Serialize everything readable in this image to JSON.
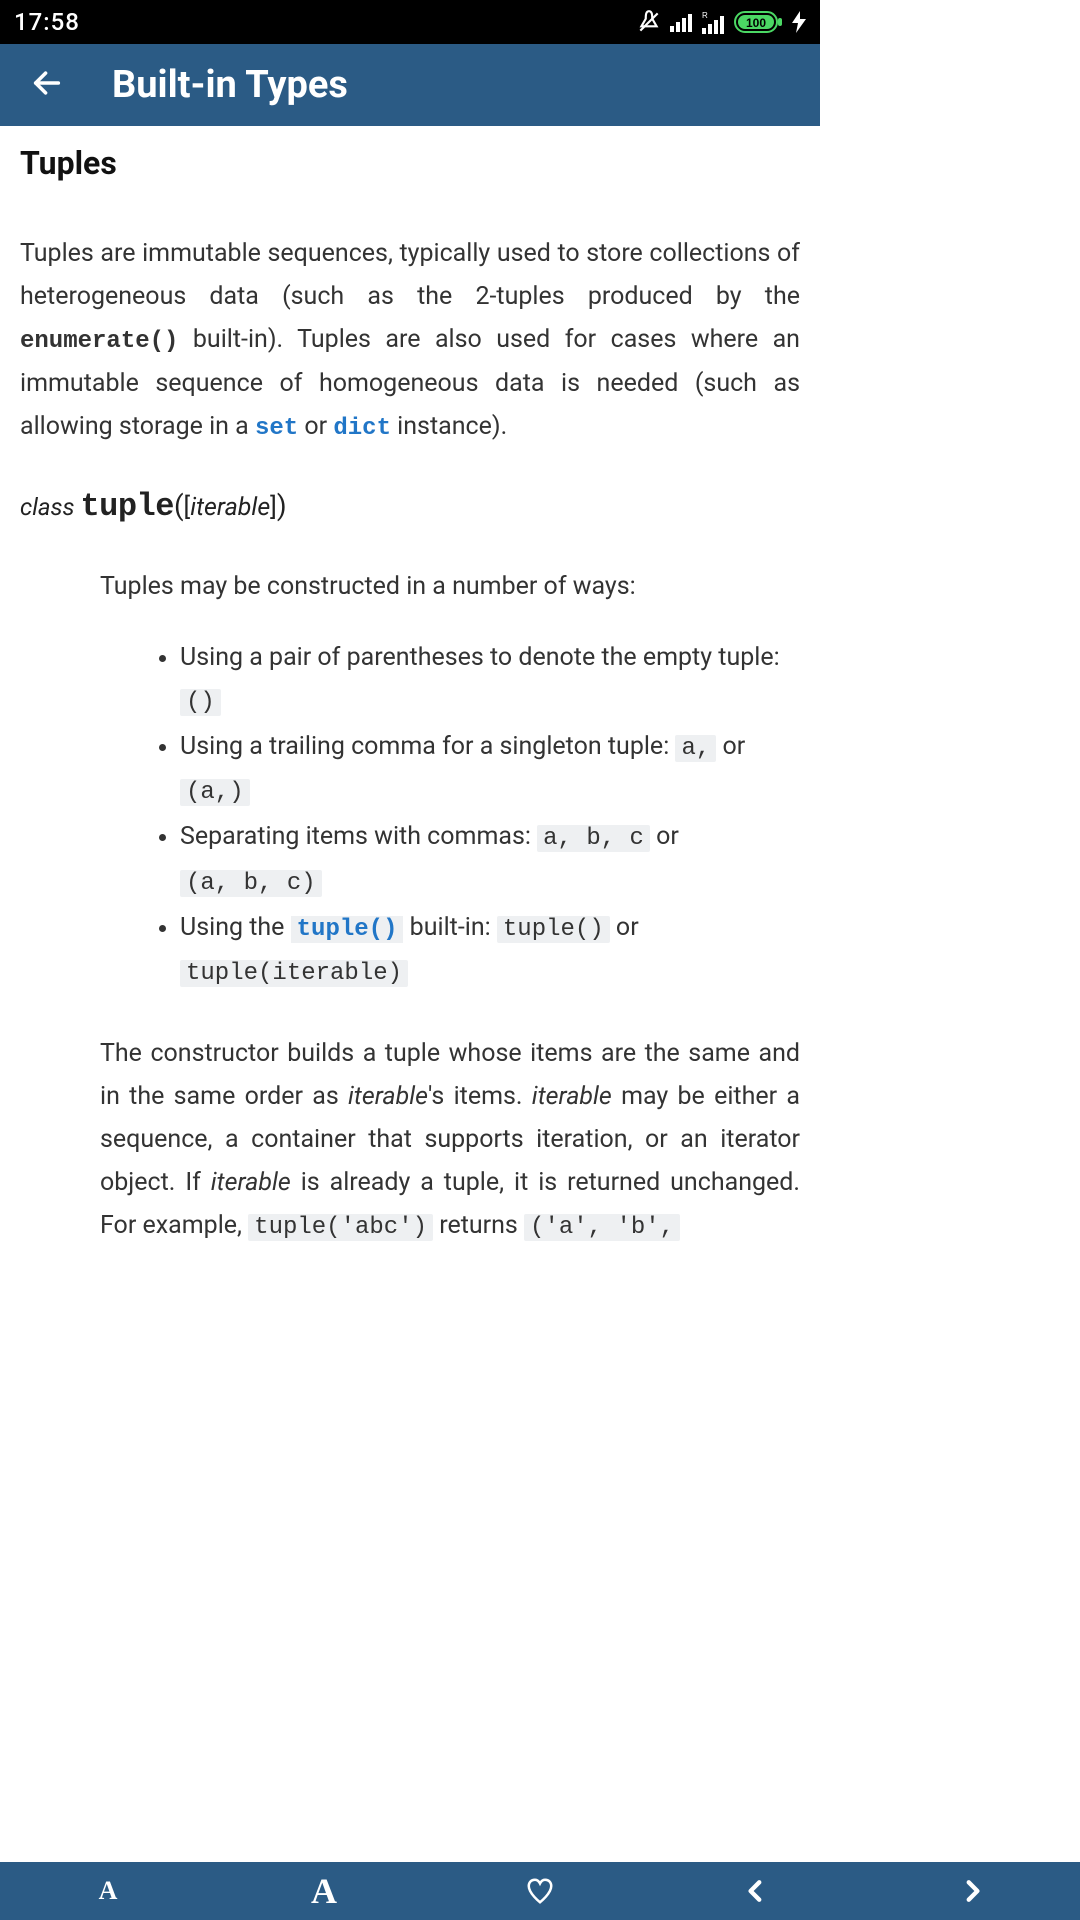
{
  "status": {
    "time": "17:58",
    "battery": "100"
  },
  "header": {
    "title": "Built-in Types"
  },
  "page": {
    "heading": "Tuples",
    "intro": {
      "p1a": "Tuples are immutable sequences, typically used to store collections of heterogeneous data (such as the 2-tuples produced by the ",
      "enum": "enumerate()",
      "p1b": " built-in). Tuples are also used for cases where an immutable sequence of homogeneous data is needed (such as allowing storage in a ",
      "set": "set",
      "or": " or ",
      "dict": "dict",
      "p1c": " instance)."
    },
    "classline": {
      "kw": "class ",
      "cls": "tuple",
      "open": "(",
      "lb": "[",
      "it": "iterable",
      "rb": "]",
      "close": ")"
    },
    "ways_intro": "Tuples may be constructed in a number of ways:",
    "bullets": {
      "b1a": "Using a pair of parentheses to denote the empty tuple: ",
      "b1c": "()",
      "b2a": "Using a trailing comma for a singleton tuple:",
      "b2c1": "a,",
      "b2or": " or ",
      "b2c2": "(a,)",
      "b3a": "Separating items with commas: ",
      "b3c1": "a, b, c",
      "b3or": " or ",
      "b3c2": "(a, b, c)",
      "b4a": "Using the ",
      "b4link": "tuple()",
      "b4b": " built-in: ",
      "b4c1": "tuple()",
      "b4or": " or ",
      "b4c2": "tuple(iterable)"
    },
    "ctor": {
      "t1": "The constructor builds a tuple whose items are the same and in the same order as ",
      "it1": "iterable",
      "t2": "'s items. ",
      "it2": "iterable",
      "t3": " may be either a sequence, a container that supports iteration, or an iterator object. If ",
      "it3": "iterable",
      "t4": " is already a tuple, it is returned unchanged. For example, ",
      "c1": "tuple('abc')",
      "t5": " returns ",
      "c2": "('a', 'b',"
    }
  },
  "bottom": {
    "smallA": "A",
    "bigA": "A"
  }
}
